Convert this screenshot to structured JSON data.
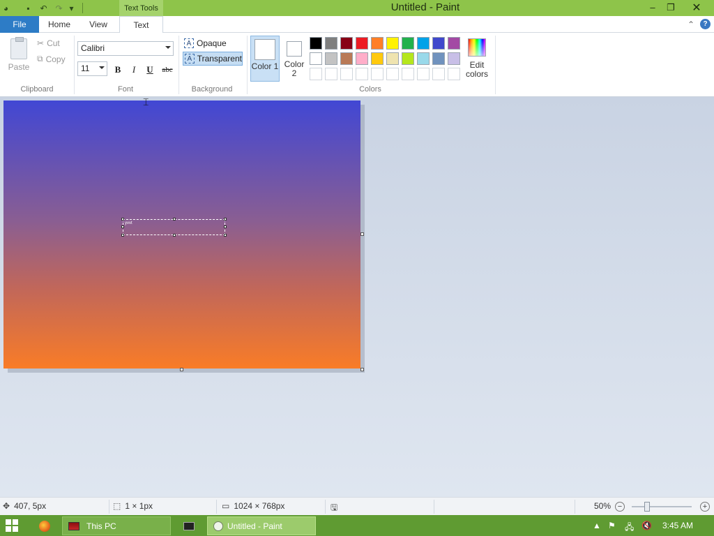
{
  "titlebar": {
    "context_tab": "Text Tools",
    "title": "Untitled - Paint",
    "controls": {
      "minimize": "–",
      "restore": "❐",
      "close": "✕"
    }
  },
  "ribbon_tabs": {
    "file": "File",
    "home": "Home",
    "view": "View",
    "text": "Text"
  },
  "clipboard": {
    "paste": "Paste",
    "cut": "Cut",
    "copy": "Copy",
    "group_label": "Clipboard"
  },
  "font": {
    "name": "Calibri",
    "size": "11",
    "bold": "B",
    "italic": "I",
    "underline": "U",
    "strike": "abc",
    "group_label": "Font"
  },
  "background": {
    "opaque": "Opaque",
    "transparent": "Transparent",
    "group_label": "Background",
    "selected": "Transparent"
  },
  "colors": {
    "color1_label": "Color 1",
    "color2_label": "Color 2",
    "edit_colors_label": "Edit colors",
    "group_label": "Colors",
    "color1": "#ffffff",
    "color2": "#ffffff",
    "palette_row1": [
      "#000000",
      "#7f7f7f",
      "#880015",
      "#ed1c24",
      "#ff7f27",
      "#fff200",
      "#22b14c",
      "#00a2e8",
      "#3f48cc",
      "#a349a4"
    ],
    "palette_row2": [
      "#ffffff",
      "#c3c3c3",
      "#b97a57",
      "#ffaec9",
      "#ffc90e",
      "#efe4b0",
      "#b5e61d",
      "#99d9ea",
      "#7092be",
      "#c8bfe7"
    ]
  },
  "canvas": {
    "text_box_content": "yvvt",
    "gradient_top": "#4147d4",
    "gradient_bottom": "#f97c27"
  },
  "statusbar": {
    "cursor_pos": "407, 5px",
    "selection_size": "1 × 1px",
    "image_size": "1024 × 768px",
    "zoom": "50%",
    "zoom_out": "−",
    "zoom_in": "+"
  },
  "taskbar": {
    "this_pc": "This PC",
    "paint": "Untitled - Paint",
    "clock": "3:45 AM"
  }
}
